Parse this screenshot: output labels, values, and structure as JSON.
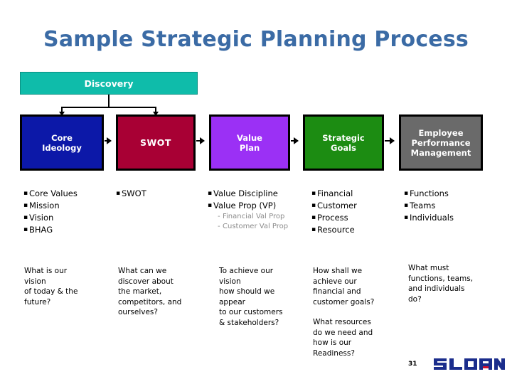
{
  "slide": {
    "title": "Sample Strategic Planning Process",
    "title_color": "#3B6BA5",
    "background": "#ffffff"
  },
  "discovery": {
    "label": "Discovery",
    "color": "#0FBCAA"
  },
  "process_boxes": [
    {
      "label": "Core\nIdeology",
      "color": "#0C18A8"
    },
    {
      "label": "SWOT",
      "color": "#A80034"
    },
    {
      "label": "Value\nPlan",
      "color": "#9B30F5"
    },
    {
      "label": "Strategic\nGoals",
      "color": "#1C8C12"
    },
    {
      "label": "Employee\nPerformance\nManagement",
      "color": "#6A6A6A"
    }
  ],
  "columns": [
    {
      "bullets": [
        "Core Values",
        "Mission",
        "Vision",
        "BHAG"
      ],
      "subbullets": [],
      "question": "What is our\nvision\nof today & the\nfuture?"
    },
    {
      "bullets": [
        "SWOT"
      ],
      "subbullets": [],
      "question": "What can we\ndiscover about\nthe market,\ncompetitors, and\nourselves?"
    },
    {
      "bullets": [
        "Value Discipline",
        "Value Prop (VP)"
      ],
      "subbullets": [
        "Financial Val Prop",
        "Customer Val Prop"
      ],
      "question": "To achieve our\nvision\nhow should we\nappear\nto our customers\n& stakeholders?"
    },
    {
      "bullets": [
        "Financial",
        "Customer",
        "Process",
        "Resource"
      ],
      "subbullets": [],
      "question": "How shall we\nachieve our\nfinancial  and\ncustomer goals?",
      "question2": "What resources\ndo we need and\nhow is our\nReadiness?"
    },
    {
      "bullets": [
        "Functions",
        "Teams",
        "Individuals"
      ],
      "subbullets": [],
      "question": "What must\nfunctions, teams,\nand individuals\ndo?"
    }
  ],
  "footer": {
    "slide_number": "31",
    "logo_text": "SLOAN",
    "logo_color": "#1B2D8C",
    "logo_accent": "#D01030"
  },
  "icons": {
    "bullet": "▪",
    "dash": "-"
  }
}
